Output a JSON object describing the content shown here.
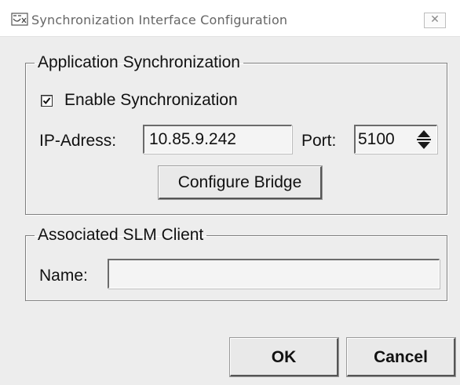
{
  "window": {
    "title": "Synchronization Interface Configuration",
    "close_label": "✕"
  },
  "app_sync": {
    "legend": "Application Synchronization",
    "enable_label": "Enable Synchronization",
    "enable_checked": true,
    "ip_label": "IP-Adress:",
    "ip_value": "10.85.9.242",
    "port_label": "Port:",
    "port_value": "5100",
    "configure_bridge_label": "Configure Bridge"
  },
  "slm_client": {
    "legend": "Associated SLM Client",
    "name_label": "Name:",
    "name_value": ""
  },
  "footer": {
    "ok_label": "OK",
    "cancel_label": "Cancel"
  },
  "icons": {
    "app": "app-icon",
    "close": "close-icon",
    "check": "check-icon",
    "spinner": "spinner-arrows-icon"
  }
}
